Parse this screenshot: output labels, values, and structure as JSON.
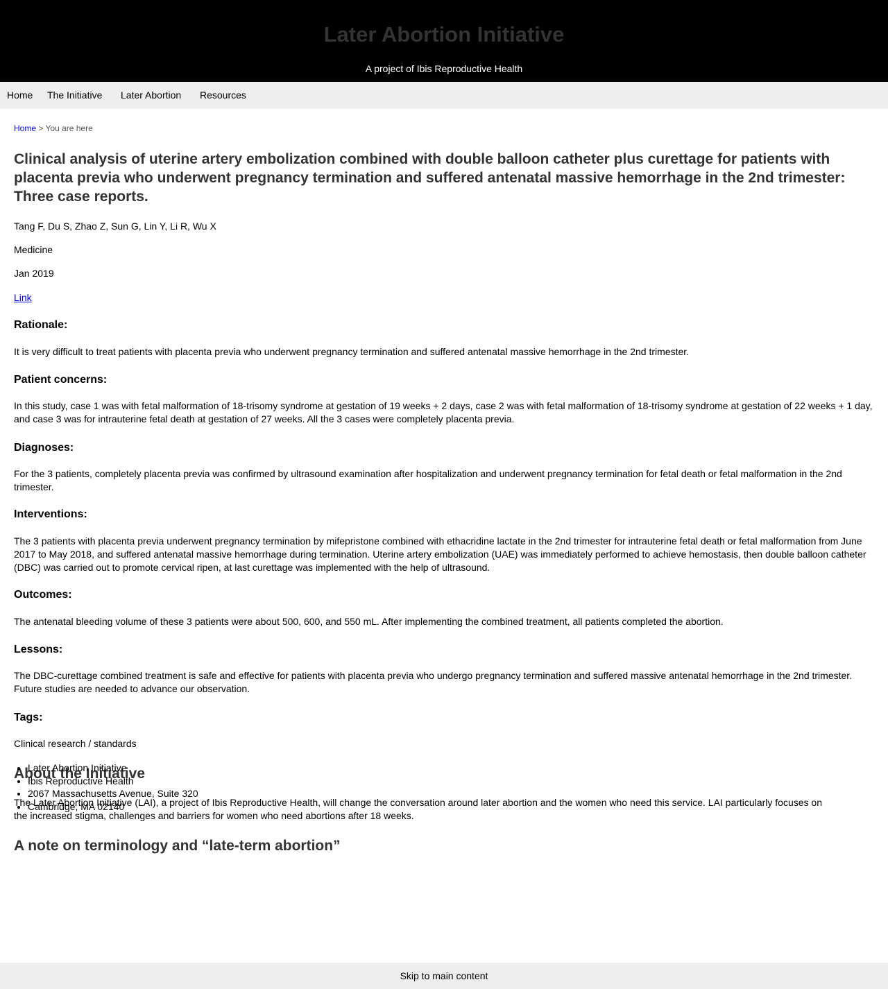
{
  "header": {
    "site_title": "Later Abortion Initiative",
    "tagline": "A project of Ibis Reproductive Health"
  },
  "nav": {
    "items": [
      {
        "label": "Home"
      },
      {
        "label": "The Initiative"
      },
      {
        "label": "Later Abortion"
      },
      {
        "label": "Resources"
      }
    ]
  },
  "breadcrumb": {
    "home": "Home",
    "separator": ">",
    "current": "You are here"
  },
  "article": {
    "title": "Clinical analysis of uterine artery embolization combined with double balloon catheter plus curettage for patients with placenta previa who underwent pregnancy termination and suffered antenatal massive hemorrhage in the 2nd trimester: Three case reports.",
    "authors": "Tang F, Du S, Zhao Z, Sun G, Lin Y, Li R, Wu X",
    "journal": "Medicine",
    "date": "Jan 2019",
    "link_label": "Link",
    "sections": {
      "rationale_heading": "Rationale:",
      "rationale_text": "It is very difficult to treat patients with placenta previa who underwent pregnancy termination and suffered antenatal massive hemorrhage in the 2nd trimester.",
      "concerns_heading": "Patient concerns:",
      "concerns_text": "In this study, case 1 was with fetal malformation of 18-trisomy syndrome at gestation of 19 weeks + 2 days, case 2 was with fetal malformation of 18-trisomy syndrome at gestation of 22 weeks + 1 day, and case 3 was for intrauterine fetal death at gestation of 27 weeks. All the 3 cases were completely placenta previa.",
      "diagnoses_heading": "Diagnoses:",
      "diagnoses_text": "For the 3 patients, completely placenta previa was confirmed by ultrasound examination after hospitalization and underwent pregnancy termination for fetal death or fetal malformation in the 2nd trimester.",
      "interventions_heading": "Interventions:",
      "interventions_text": "The 3 patients with placenta previa underwent pregnancy termination by mifepristone combined with ethacridine lactate in the 2nd trimester for intrauterine fetal death or fetal malformation from June 2017 to May 2018, and suffered antenatal massive hemorrhage during termination. Uterine artery embolization (UAE) was immediately performed to achieve hemostasis, then double balloon catheter (DBC) was carried out to promote cervical ripen, at last curettage was implemented with the help of ultrasound.",
      "outcomes_heading": "Outcomes:",
      "outcomes_text": "The antenatal bleeding volume of these 3 patients were about 500, 600, and 550 mL. After implementing the combined treatment, all patients completed the abortion.",
      "lessons_heading": "Lessons:",
      "lessons_text": "The DBC-curettage combined treatment is safe and effective for patients with placenta previa who undergo pregnancy termination and suffered massive antenatal hemorrhage in the 2nd trimester. Future studies are needed to advance our observation.",
      "tags_heading": "Tags:",
      "tags_value": "Clinical research / standards"
    }
  },
  "about": {
    "heading": "About the Initiative",
    "text": "The Later Abortion Initiative (LAI), a project of Ibis Reproductive Health, will change the conversation around later abortion and the women who need this service. LAI particularly focuses on the increased stigma, challenges and barriers for women who need abortions after 18 weeks.",
    "note_heading_prefix": "A note ",
    "note_heading_link": "on terminology and “late-term abortion”"
  },
  "contact": {
    "lines": [
      "Later Abortion Initiative",
      "Ibis Reproductive Health",
      "2067 Massachusetts Avenue, Suite 320",
      "Cambridge, MA 02140"
    ]
  },
  "footer": {
    "skip_link": "Skip to main content"
  }
}
